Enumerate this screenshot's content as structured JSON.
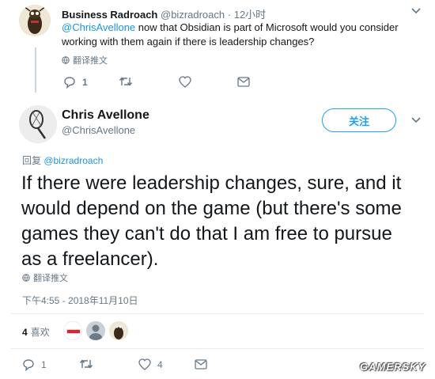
{
  "reply_tweet": {
    "display_name": "Business Radroach",
    "handle": "@bizradroach",
    "separator": "·",
    "time": "12小时",
    "mention": "@ChrisAvellone",
    "text_line1": " now that Obsidian is part of Microsoft would you consider",
    "text_line2": "working with them again if there is leadership changes?",
    "translate_label": "翻译推文",
    "reply_count": "1",
    "retweet_count": "",
    "like_count": ""
  },
  "main_tweet": {
    "display_name": "Chris Avellone",
    "handle": "@ChrisAvellone",
    "follow_label": "关注",
    "reply_to_prefix": "回复",
    "reply_to_handle": "@bizradroach",
    "text_lines": [
      "If there were leadership changes, sure, and it",
      "would depend on the game (but there's some",
      "games they can't do that I am free to pursue",
      "as a freelancer)."
    ],
    "translate_label": "翻译推文",
    "timestamp": "下午4:55 - 2018年11月10日",
    "likes_count": "4",
    "likes_label": "喜欢",
    "reply_count": "1",
    "like_count": "4"
  },
  "watermark": "GAMERSKY",
  "colors": {
    "link_blue": "#1b95e0",
    "follow_blue": "#1da1f2",
    "gray_text": "#657786",
    "divider": "#e6ecf0"
  }
}
